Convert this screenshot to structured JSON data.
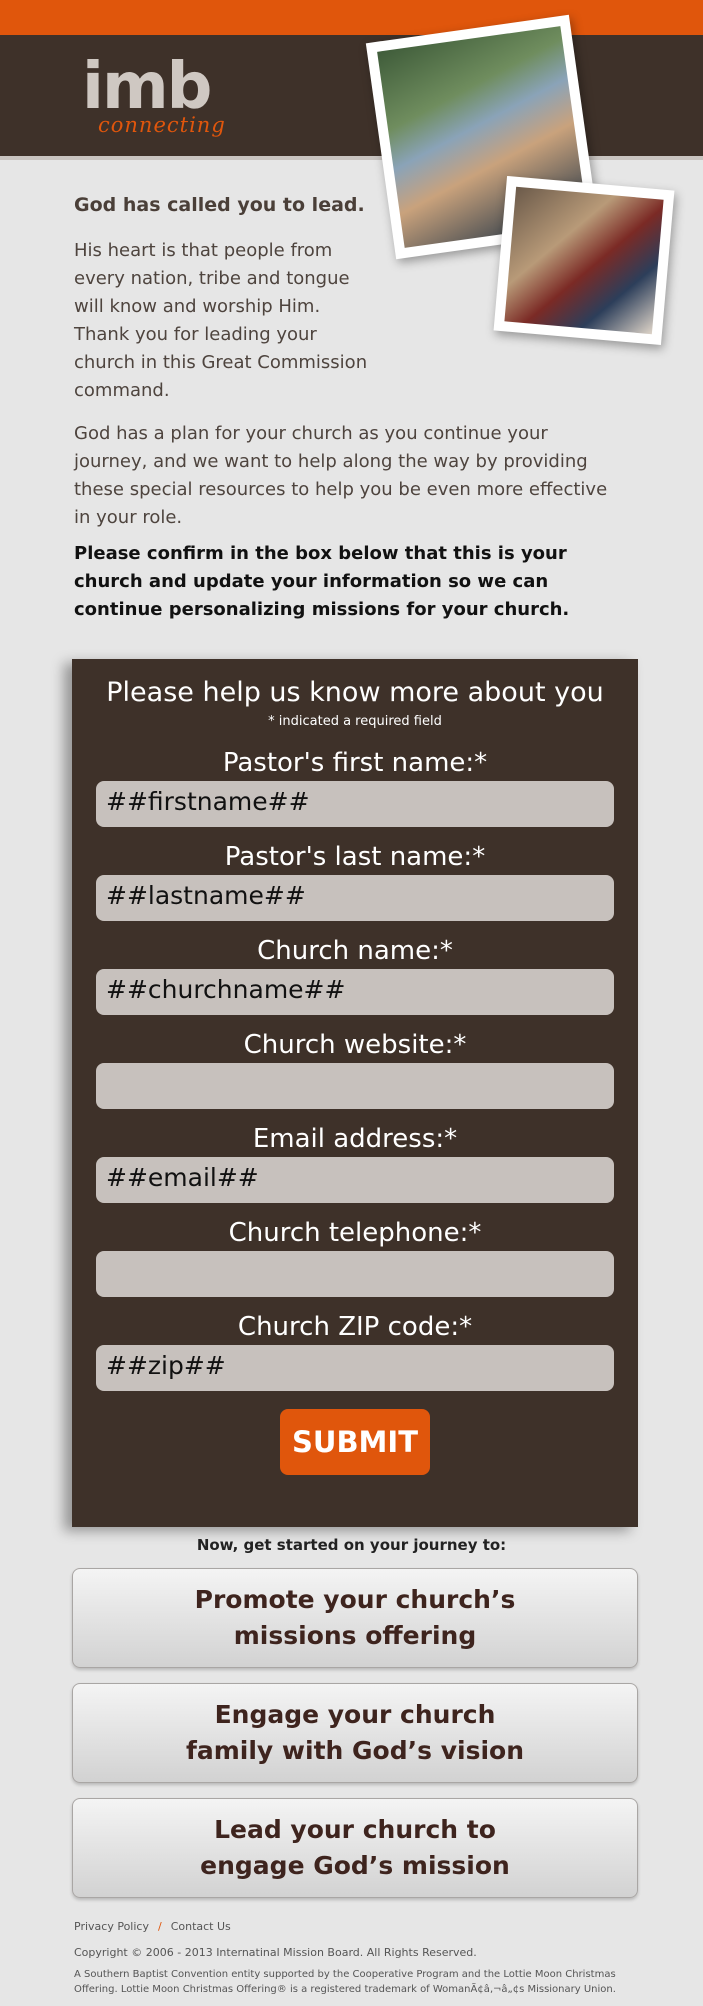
{
  "brand": {
    "logo_main": "imb",
    "logo_sub": "connecting",
    "accent": "#e0560c",
    "dark": "#3e3129"
  },
  "intro": {
    "headline": "God has called you to lead.",
    "para1": "His heart is that people from every nation, tribe and tongue will know and worship Him. Thank you for leading your church in this Great Commission command.",
    "para2": "God has a plan for your church as you continue your journey, and we want to help along the way by providing these special resources to help you be even more effective in your role.",
    "para3": "Please confirm in the box below that this is your church and update your information so we can continue personalizing missions for your church."
  },
  "form": {
    "title": "Please help us know more about you",
    "note": "* indicated a required field",
    "fields": [
      {
        "label": "Pastor's first name:*",
        "value": "##firstname##"
      },
      {
        "label": "Pastor's last name:*",
        "value": "##lastname##"
      },
      {
        "label": "Church name:*",
        "value": "##churchname##"
      },
      {
        "label": "Church website:*",
        "value": ""
      },
      {
        "label": "Email address:*",
        "value": "##email##"
      },
      {
        "label": "Church telephone:*",
        "value": ""
      },
      {
        "label": "Church ZIP code:*",
        "value": "##zip##"
      }
    ],
    "submit_label": "SUBMIT"
  },
  "journey": {
    "heading": "Now, get started on your journey to:",
    "buttons": [
      "Promote your church’s\nmissions offering",
      "Engage your church\nfamily with God’s vision",
      "Lead your church to\nengage God’s mission"
    ]
  },
  "footer": {
    "privacy": "Privacy Policy",
    "separator": "/",
    "contact": "Contact Us",
    "copyright": "Copyright © 2006 - 2013 Internatinal Mission Board. All Rights Reserved.",
    "legal": "A Southern Baptist Convention entity supported by the Cooperative Program and the Lottie Moon Christmas Offering. Lottie Moon Christmas Offering® is a registered trademark of WomanÃ¢â‚¬â„¢s Missionary Union."
  }
}
